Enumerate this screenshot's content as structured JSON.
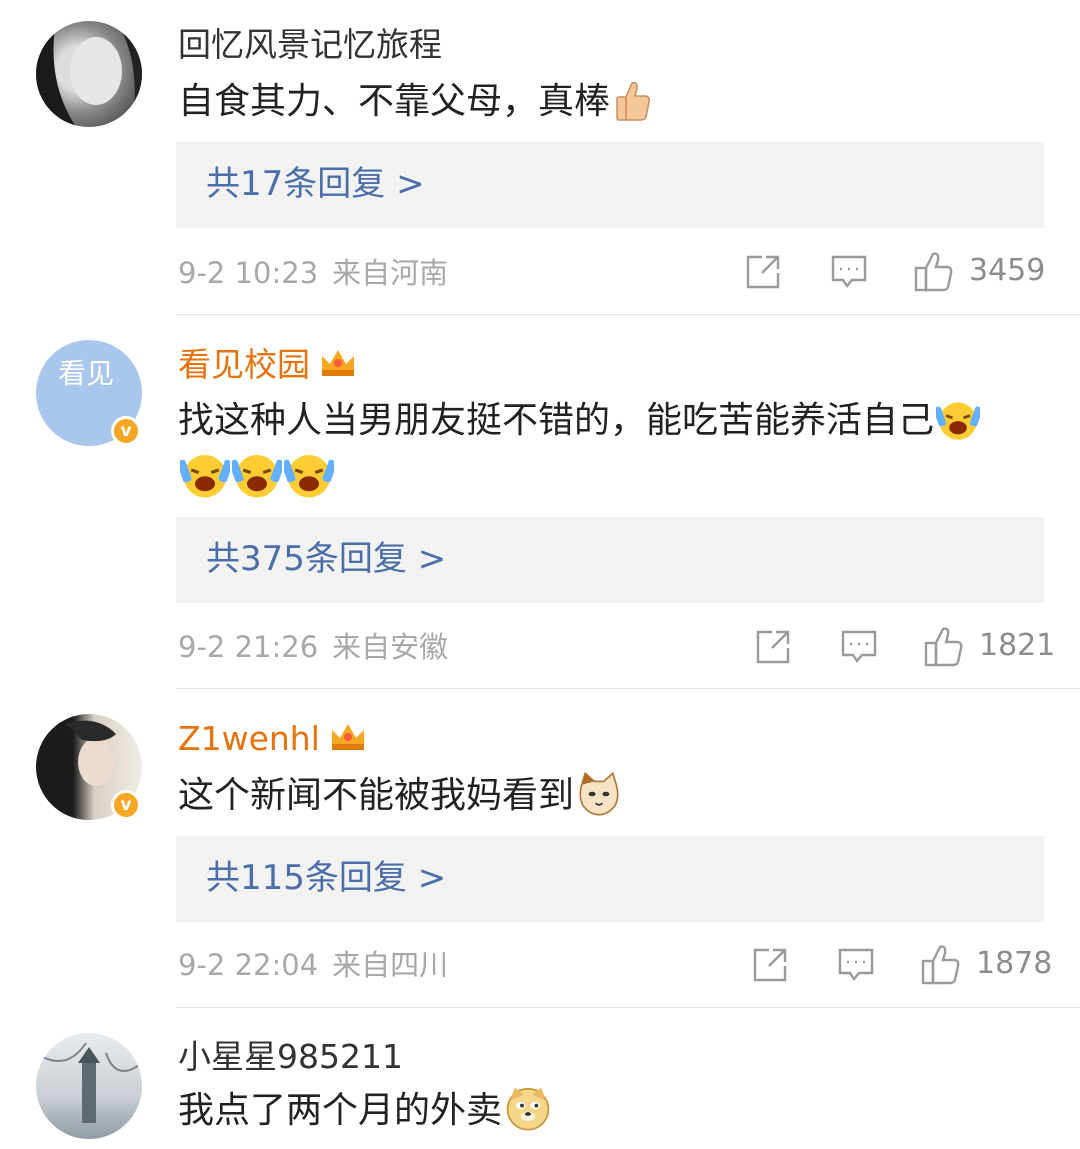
{
  "comments": [
    {
      "username": "回忆风景记忆旅程",
      "text": "自食其力、不靠父母，真棒",
      "emoji": "thumbs-up",
      "replies": "共17条回复 >",
      "time": "9-2 10:23",
      "location": "来自河南",
      "likes": "3459",
      "vip": false,
      "verified": false
    },
    {
      "username": "看见校园",
      "avatar_text": "看见",
      "text": "找这种人当男朋友挺不错的，能吃苦能养活自己",
      "emoji": "laugh-cry",
      "replies": "共375条回复 >",
      "time": "9-2 21:26",
      "location": "来自安徽",
      "likes": "1821",
      "vip": true,
      "verified": true
    },
    {
      "username": "Z1wenhl",
      "text": "这个新闻不能被我妈看到",
      "emoji": "cat-face",
      "replies": "共115条回复 >",
      "time": "9-2 22:04",
      "location": "来自四川",
      "likes": "1878",
      "vip": true,
      "verified": true
    },
    {
      "username": "小星星985211",
      "text": "我点了两个月的外卖",
      "emoji": "doge",
      "vip": false,
      "verified": false
    }
  ],
  "colors": {
    "vip_name": "#e8730c",
    "reply_link": "#4a6ea8",
    "meta": "#a8a8a8",
    "reply_bg": "#f2f2f2",
    "verified_badge": "#f5a623"
  }
}
